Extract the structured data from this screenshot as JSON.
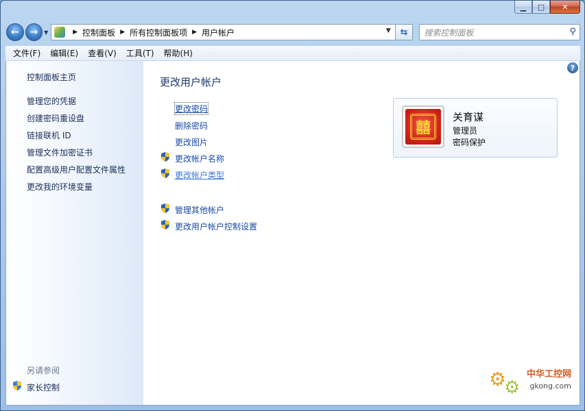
{
  "window": {
    "caption": {
      "minimize": "▁",
      "maximize": "□",
      "close": "✕"
    }
  },
  "nav": {
    "back_icon": "arrow-left-icon",
    "forward_icon": "arrow-right-icon",
    "breadcrumb": [
      "控制面板",
      "所有控制面板项",
      "用户帐户"
    ],
    "search_placeholder": "搜索控制面板"
  },
  "menu": [
    "文件(F)",
    "编辑(E)",
    "查看(V)",
    "工具(T)",
    "帮助(H)"
  ],
  "sidebar": {
    "home": "控制面板主页",
    "links": [
      "管理您的凭据",
      "创建密码重设盘",
      "链接联机 ID",
      "管理文件加密证书",
      "配置高级用户配置文件属性",
      "更改我的环境变量"
    ],
    "see_also_heading": "另请参阅",
    "see_also": [
      "家长控制"
    ]
  },
  "main": {
    "title": "更改用户帐户",
    "tasks": [
      {
        "label": "更改密码",
        "shield": false,
        "state": "focused"
      },
      {
        "label": "删除密码",
        "shield": false,
        "state": "normal"
      },
      {
        "label": "更改图片",
        "shield": false,
        "state": "normal"
      },
      {
        "label": "更改帐户名称",
        "shield": true,
        "state": "normal"
      },
      {
        "label": "更改帐户类型",
        "shield": true,
        "state": "hovered"
      }
    ],
    "other_tasks": [
      {
        "label": "管理其他帐户",
        "shield": true
      },
      {
        "label": "更改用户帐户控制设置",
        "shield": true
      }
    ],
    "help": "?"
  },
  "account": {
    "name": "关育谋",
    "role": "管理员",
    "status": "密码保护"
  },
  "watermark": {
    "text": "中华工控网",
    "url": "gkong.com"
  },
  "colors": {
    "link": "#1b4aa5",
    "title": "#1e3a6e",
    "accent": "#d3241a"
  }
}
